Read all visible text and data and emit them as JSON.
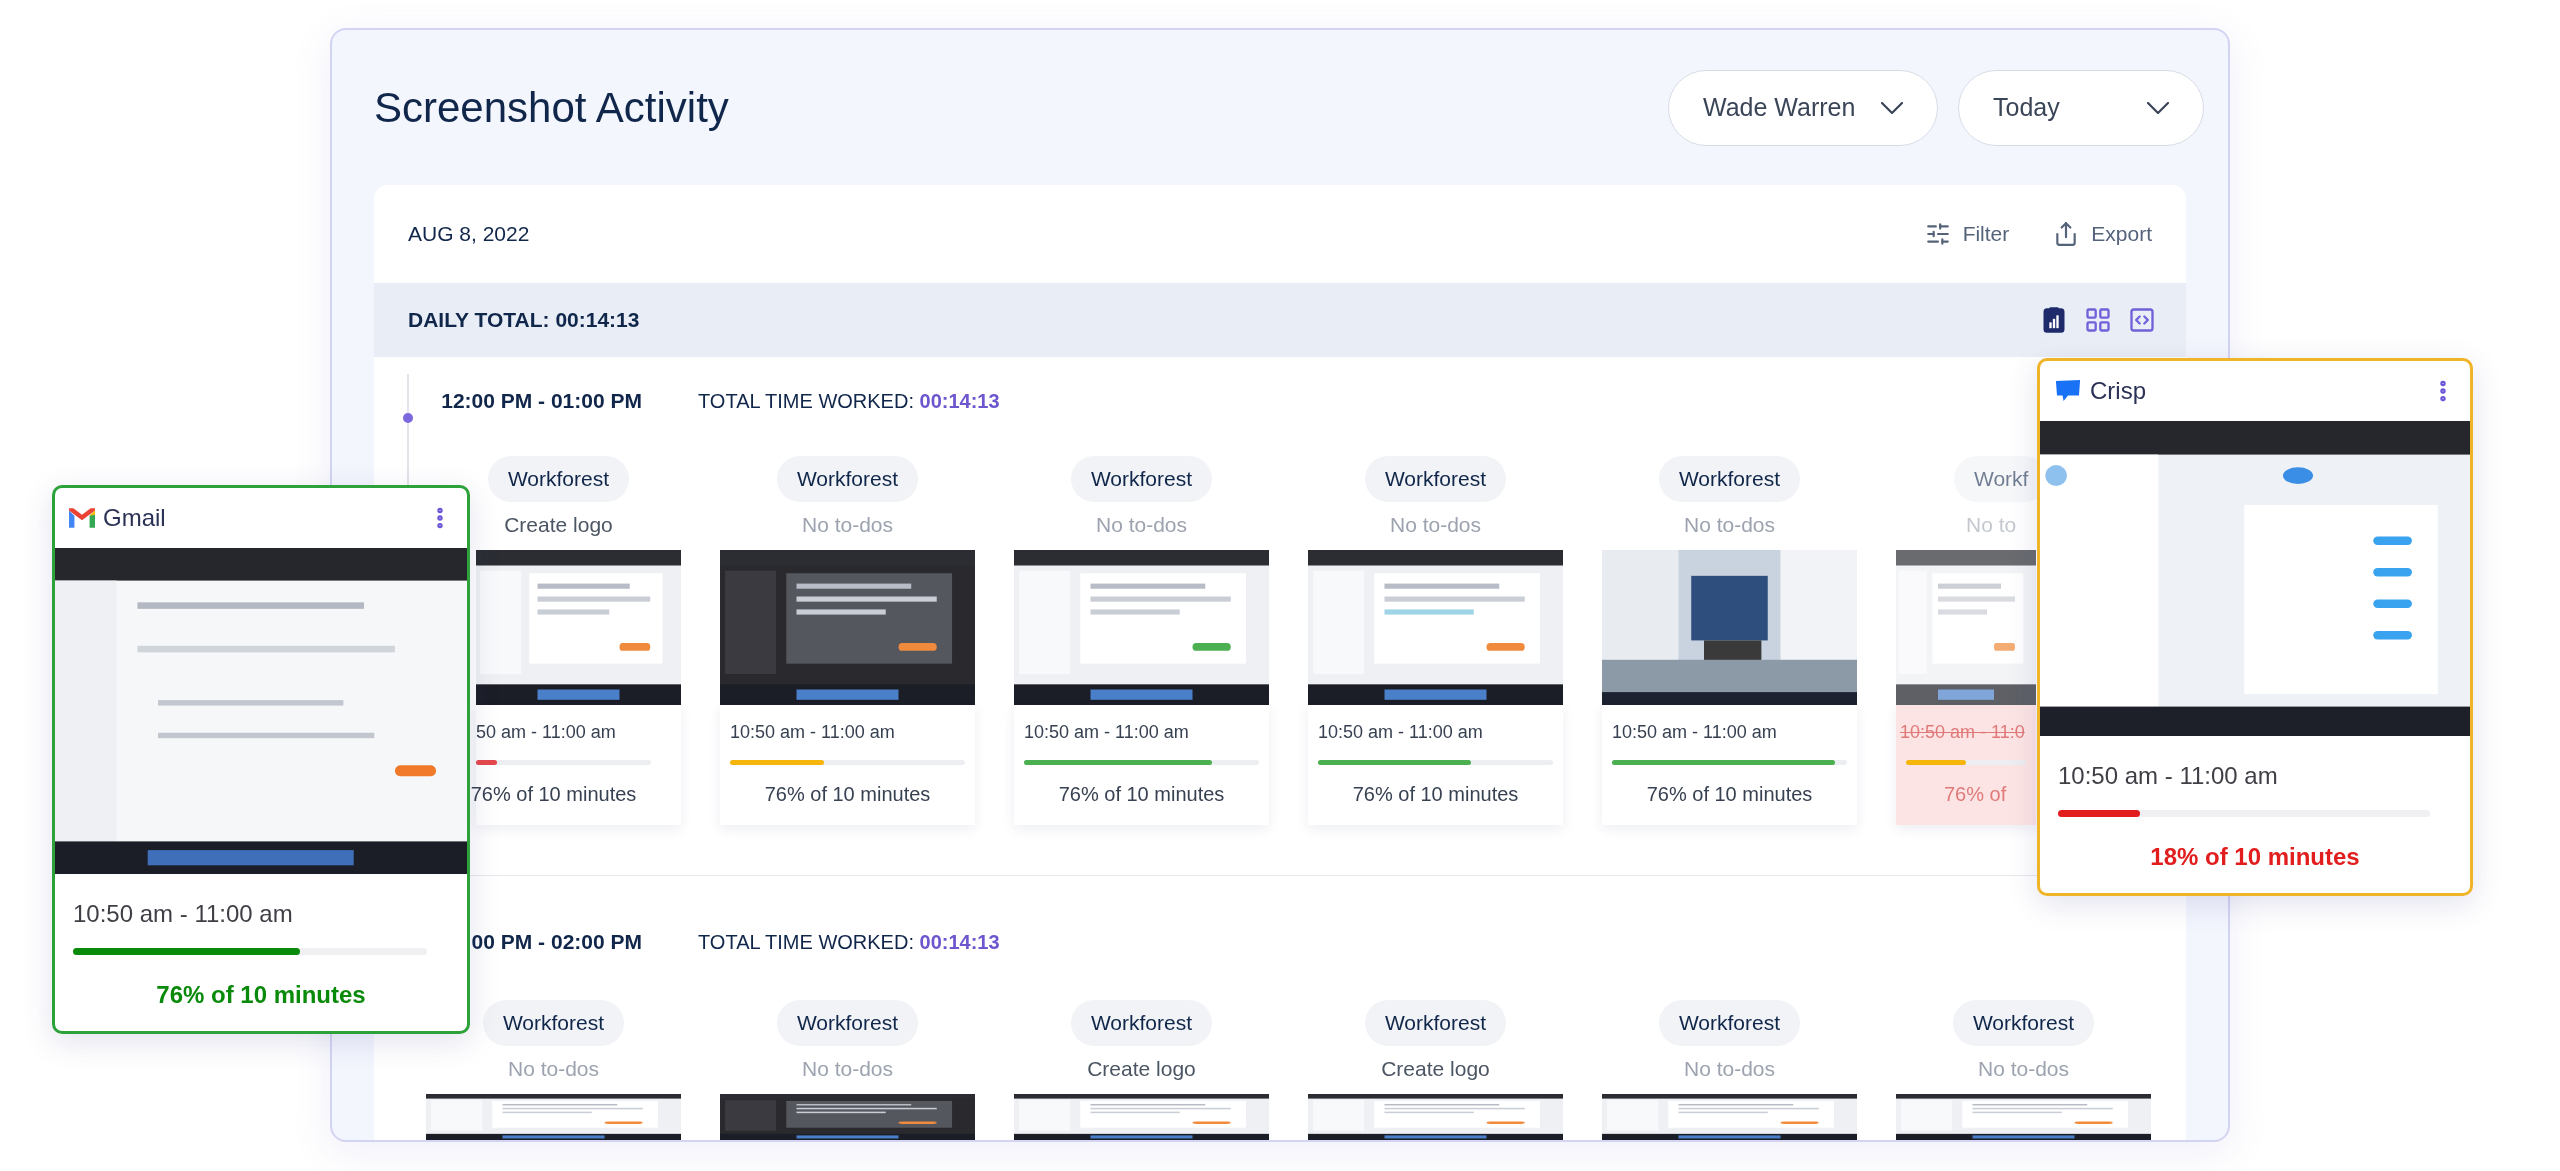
{
  "title": "Screenshot Activity",
  "filters": [
    {
      "label": "Wade Warren"
    },
    {
      "label": "Today"
    }
  ],
  "date": "AUG 8, 2022",
  "actions": [
    {
      "label": "Filter",
      "kind": "filter"
    },
    {
      "label": "Export",
      "kind": "export"
    }
  ],
  "daily_total": "DAILY TOTAL: 00:14:13",
  "views": [
    {
      "kind": "report",
      "selected": true
    },
    {
      "kind": "grid",
      "selected": false
    },
    {
      "kind": "code",
      "selected": false
    }
  ],
  "sections": [
    {
      "time_range": "12:00 PM - 01:00 PM",
      "total_label": "TOTAL TIME WORKED:",
      "total_value": "00:14:13",
      "cards": [
        {
          "kind": "clipped_left",
          "project": "Workforest",
          "todo": "Create logo",
          "has_todo": true,
          "time": "50 am - 11:00 am",
          "level": 0.12,
          "color": "#e5484d",
          "percent": "76% of 10 minutes",
          "flagged": false
        },
        {
          "kind": "full",
          "project": "Workforest",
          "todo": "No to-dos",
          "has_todo": false,
          "time": "10:50 am - 11:00 am",
          "level": 0.4,
          "color": "#f5b50a",
          "percent": "76% of 10 minutes",
          "flagged": false
        },
        {
          "kind": "full",
          "project": "Workforest",
          "todo": "No to-dos",
          "has_todo": false,
          "time": "10:50 am - 11:00 am",
          "level": 0.8,
          "color": "#4caf50",
          "percent": "76% of 10 minutes",
          "flagged": false
        },
        {
          "kind": "full",
          "project": "Workforest",
          "todo": "No to-dos",
          "has_todo": false,
          "time": "10:50 am - 11:00 am",
          "level": 0.65,
          "color": "#4caf50",
          "percent": "76% of 10 minutes",
          "flagged": false
        },
        {
          "kind": "full",
          "project": "Workforest",
          "todo": "No to-dos",
          "has_todo": false,
          "time": "10:50 am - 11:00 am",
          "level": 0.95,
          "color": "#4caf50",
          "percent": "76% of 10 minutes",
          "flagged": false
        },
        {
          "kind": "clipped_right",
          "project": "Workf",
          "todo": "No to",
          "has_todo": false,
          "time": "10:50 am - 11:0",
          "level": 0.5,
          "color": "#f5b50a",
          "percent": "76% of",
          "flagged": true
        }
      ]
    },
    {
      "time_range": "00 PM - 02:00 PM",
      "total_label": "TOTAL TIME WORKED:",
      "total_value": "00:14:13",
      "cards": [
        {
          "kind": "full",
          "project": "Workforest",
          "todo": "No to-dos",
          "has_todo": false
        },
        {
          "kind": "full",
          "project": "Workforest",
          "todo": "No to-dos",
          "has_todo": false
        },
        {
          "kind": "full",
          "project": "Workforest",
          "todo": "Create logo",
          "has_todo": true
        },
        {
          "kind": "full",
          "project": "Workforest",
          "todo": "Create logo",
          "has_todo": true
        },
        {
          "kind": "full",
          "project": "Workforest",
          "todo": "No to-dos",
          "has_todo": false
        },
        {
          "kind": "full",
          "project": "Workforest",
          "todo": "No to-dos",
          "has_todo": false
        }
      ]
    }
  ],
  "popups": [
    {
      "app": "Gmail",
      "kind": "gmail",
      "color": "#0a8a0a",
      "time": "10:50 am - 11:00 am",
      "level": 0.64,
      "percent": "76% of 10 minutes"
    },
    {
      "app": "Crisp",
      "kind": "crisp",
      "color": "#e11d1d",
      "time": "10:50 am - 11:00 am",
      "level": 0.22,
      "percent": "18% of 10 minutes"
    }
  ]
}
